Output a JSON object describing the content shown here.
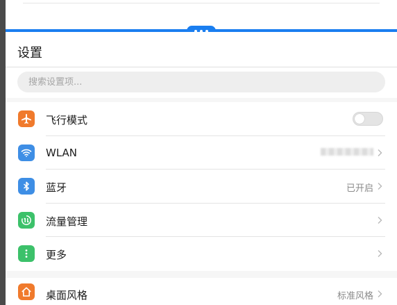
{
  "panel": {
    "title": "设置",
    "search_placeholder": "搜索设置项..."
  },
  "groups": [
    {
      "items": [
        {
          "label": "飞行模式",
          "control": "toggle",
          "toggle_on": false,
          "icon": "airplane-icon",
          "icon_color": "#f07a2c"
        },
        {
          "label": "WLAN",
          "value": "",
          "value_redacted": true,
          "icon": "wifi-icon",
          "icon_color": "#3e8ee5"
        },
        {
          "label": "蓝牙",
          "value": "已开启",
          "icon": "bluetooth-icon",
          "icon_color": "#3e8ee5"
        },
        {
          "label": "流量管理",
          "value": "",
          "icon": "data-usage-icon",
          "icon_color": "#3cc16a"
        },
        {
          "label": "更多",
          "value": "",
          "icon": "more-vertical-icon",
          "icon_color": "#3cc16a"
        }
      ]
    },
    {
      "items": [
        {
          "label": "桌面风格",
          "value": "标准风格",
          "icon": "home-icon",
          "icon_color": "#f07a2c"
        }
      ]
    }
  ],
  "colors": {
    "accent": "#1a7ef0",
    "toggle_off": "#e4e4e4"
  }
}
